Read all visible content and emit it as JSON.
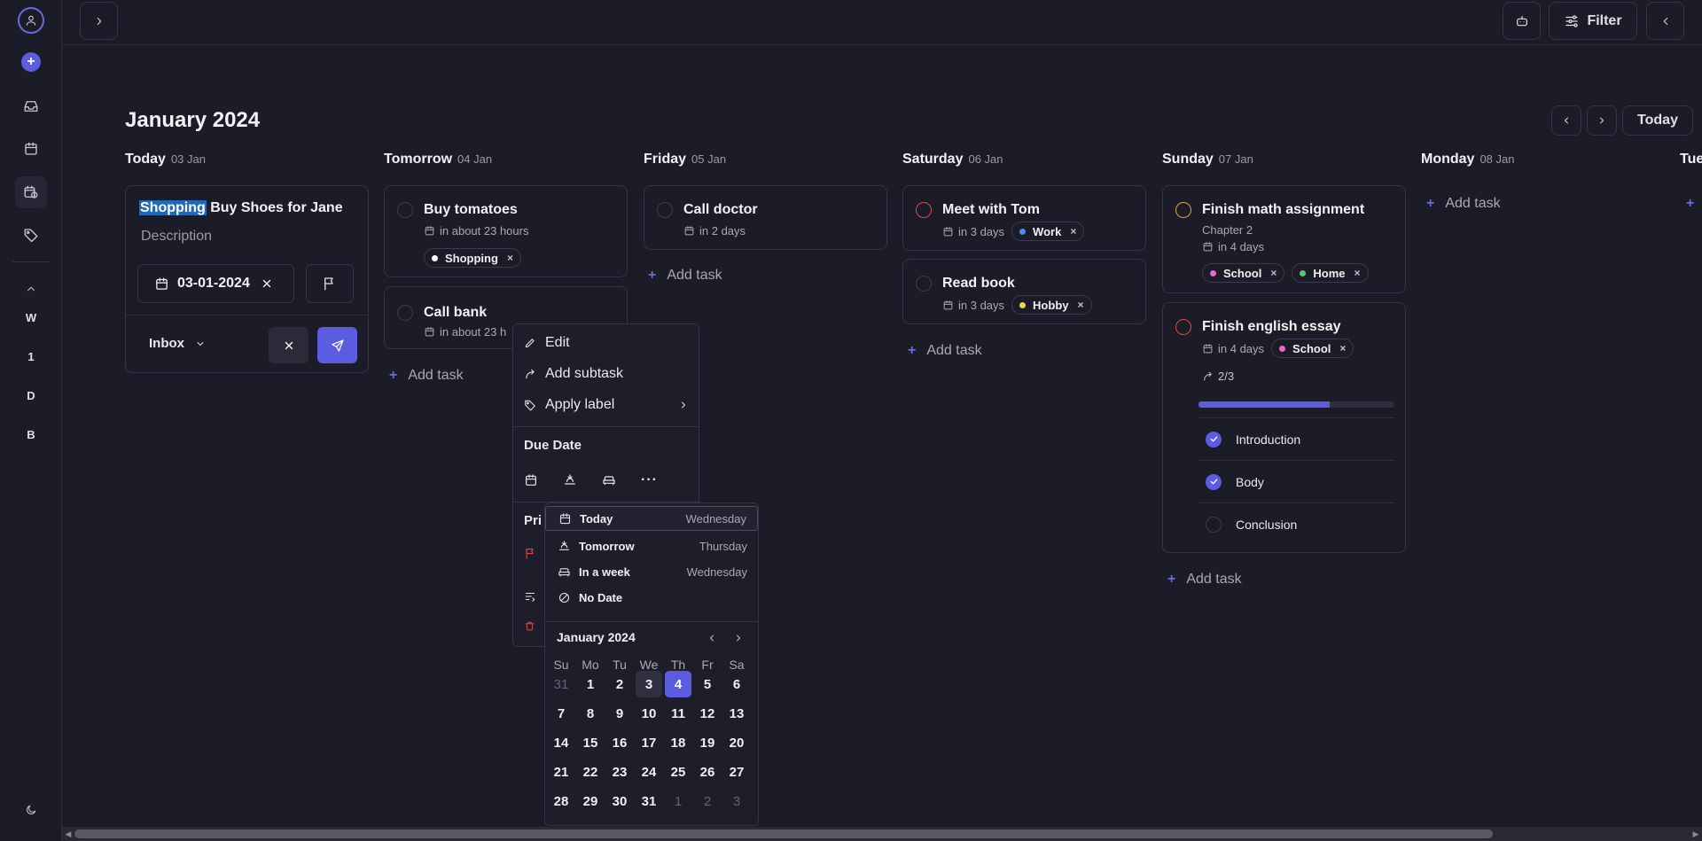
{
  "header": {
    "filter_label": "Filter"
  },
  "sidebar": {
    "letters": [
      "W",
      "1",
      "D",
      "B"
    ]
  },
  "calendar_view": {
    "month_title": "January 2024",
    "today_label": "Today"
  },
  "columns": [
    {
      "day": "Today",
      "date": "03 Jan"
    },
    {
      "day": "Tomorrow",
      "date": "04 Jan"
    },
    {
      "day": "Friday",
      "date": "05 Jan"
    },
    {
      "day": "Saturday",
      "date": "06 Jan"
    },
    {
      "day": "Sunday",
      "date": "07 Jan"
    },
    {
      "day": "Monday",
      "date": "08 Jan"
    },
    {
      "day": "Tue",
      "date": ""
    }
  ],
  "editor": {
    "title_label": "Shopping",
    "title_text": " Buy Shoes for Jane",
    "description_placeholder": "Description",
    "date_value": "03-01-2024",
    "project": "Inbox"
  },
  "tasks": {
    "buy_tomatoes": {
      "title": "Buy tomatoes",
      "due": "in about 23 hours",
      "tag": "Shopping"
    },
    "call_bank": {
      "title": "Call bank",
      "due": "in about 23 h"
    },
    "call_doctor": {
      "title": "Call doctor",
      "due": "in 2 days"
    },
    "meet_tom": {
      "title": "Meet with Tom",
      "due": "in 3 days",
      "tag": "Work"
    },
    "read_book": {
      "title": "Read book",
      "due": "in 3 days",
      "tag": "Hobby"
    },
    "math": {
      "title": "Finish math assignment",
      "subtitle": "Chapter 2",
      "due": "in 4 days",
      "tags": [
        "School",
        "Home"
      ]
    },
    "essay": {
      "title": "Finish english essay",
      "due": "in 4 days",
      "tag": "School",
      "subtask_count": "2/3",
      "progress": 0.67,
      "subtasks": [
        "Introduction",
        "Body",
        "Conclusion"
      ]
    }
  },
  "add_task_label": "Add task",
  "context_menu": {
    "edit": "Edit",
    "add_subtask": "Add subtask",
    "apply_label": "Apply label",
    "due_date_heading": "Due Date",
    "priority_heading_partial": "Pri"
  },
  "date_popup": {
    "options": [
      {
        "label": "Today",
        "weekday": "Wednesday"
      },
      {
        "label": "Tomorrow",
        "weekday": "Thursday"
      },
      {
        "label": "In a week",
        "weekday": "Wednesday"
      },
      {
        "label": "No Date",
        "weekday": ""
      }
    ],
    "month_label": "January 2024",
    "weekdays": [
      "Su",
      "Mo",
      "Tu",
      "We",
      "Th",
      "Fr",
      "Sa"
    ],
    "weeks": [
      [
        "31",
        "1",
        "2",
        "3",
        "4",
        "5",
        "6"
      ],
      [
        "7",
        "8",
        "9",
        "10",
        "11",
        "12",
        "13"
      ],
      [
        "14",
        "15",
        "16",
        "17",
        "18",
        "19",
        "20"
      ],
      [
        "21",
        "22",
        "23",
        "24",
        "25",
        "26",
        "27"
      ],
      [
        "28",
        "29",
        "30",
        "31",
        "1",
        "2",
        "3"
      ]
    ],
    "today_day": "3",
    "selected_day": "4"
  },
  "colors": {
    "accent": "#5c5ce0",
    "shopping": "#ffffff",
    "work": "#4a8ae8",
    "hobby": "#e8d84a",
    "school": "#e86ac8",
    "home": "#5ac86a",
    "priority_high": "#d84a4a",
    "priority_medium": "#d8a830"
  }
}
